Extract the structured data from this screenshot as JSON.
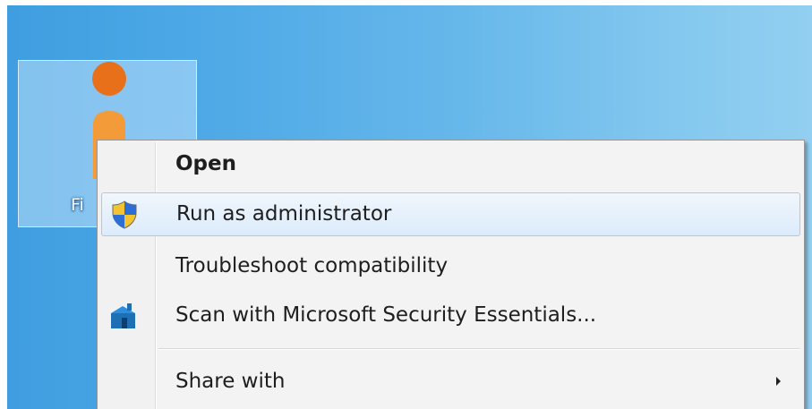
{
  "desktop": {
    "icon": {
      "label": "Fi",
      "icon_name": "person-icon",
      "colors": {
        "head": "#e8701a",
        "body": "#f39a39"
      }
    }
  },
  "context_menu": {
    "items": [
      {
        "label": "Open",
        "bold": true
      },
      {
        "label": "Run as administrator",
        "icon": "uac-shield-icon",
        "hovered": true
      },
      {
        "label": "Troubleshoot compatibility"
      },
      {
        "label": "Scan with Microsoft Security Essentials...",
        "icon": "security-essentials-icon"
      },
      {
        "label": "Share with",
        "has_submenu": true
      }
    ]
  },
  "colors": {
    "desktop_left": "#3f9ee0",
    "desktop_right": "#92cff0",
    "menu_background": "#f3f3f3",
    "hover_border": "#a8cbeb"
  }
}
